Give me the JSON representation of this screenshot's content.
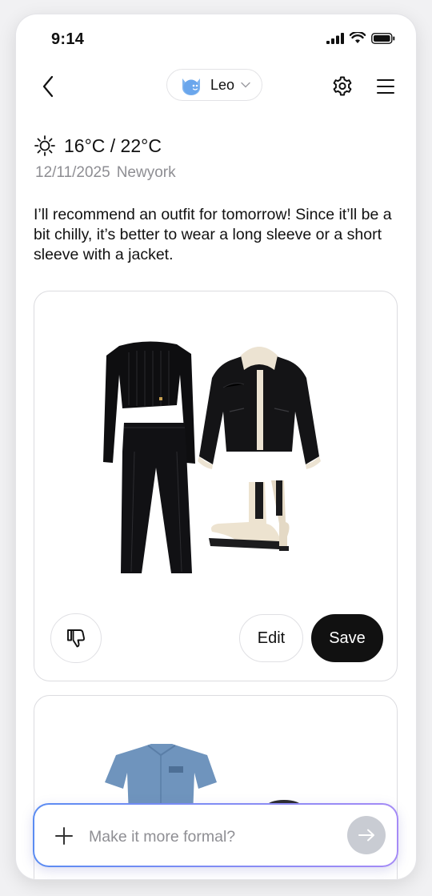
{
  "status_bar": {
    "time": "9:14"
  },
  "header": {
    "profile_name": "Leo",
    "icons": [
      "back-icon",
      "avatar",
      "chevron-down-icon",
      "gear-icon",
      "menu-icon"
    ]
  },
  "weather": {
    "temperature": "16°C / 22°C",
    "date": "12/11/2025",
    "location": "Newyork",
    "icon": "sun-icon"
  },
  "recommendation": {
    "message": "I’ll recommend an outfit for tomorrow! Since it’ll be a bit chilly, it’s better to wear a long sleeve or a short sleeve with a jacket."
  },
  "outfit_card": {
    "items": [
      "black off-shoulder crop knit",
      "black leather shearling jacket",
      "black wide-leg trousers",
      "cream chelsea boots"
    ],
    "edit_label": "Edit",
    "save_label": "Save"
  },
  "outfit_card_2": {
    "items": [
      "denim short sleeve shirt"
    ]
  },
  "chat": {
    "placeholder": "Make it more formal?"
  },
  "colors": {
    "accent_start": "#5b8cf2",
    "accent_end": "#a58bf6",
    "save_bg": "#111111"
  }
}
